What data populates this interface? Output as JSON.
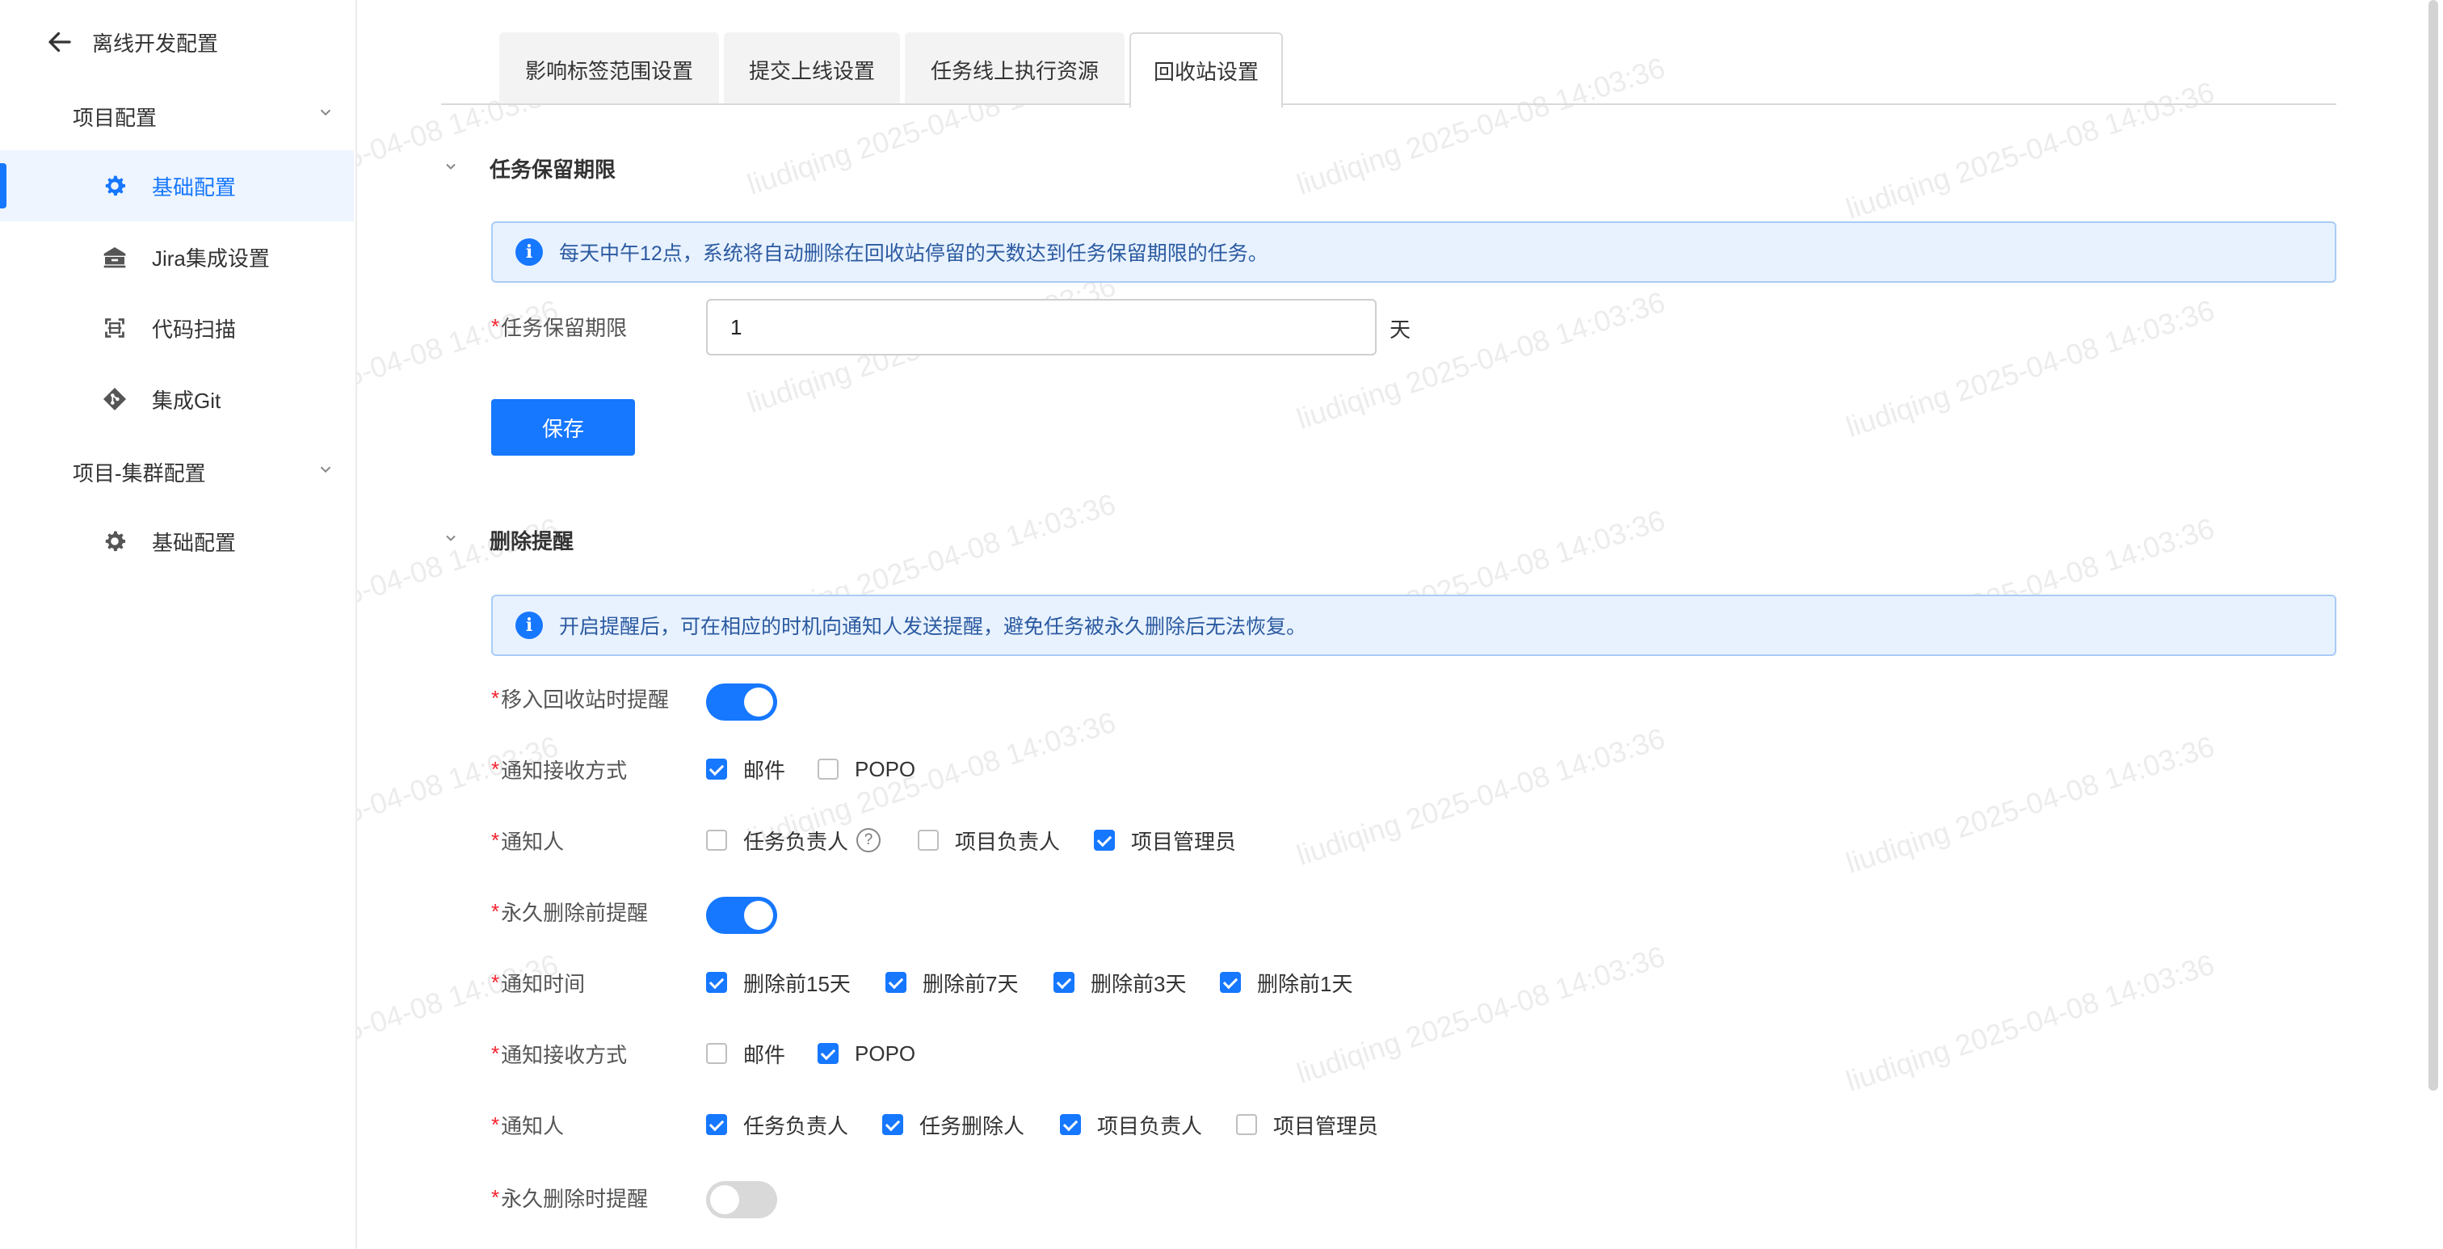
{
  "sidebar": {
    "title": "离线开发配置",
    "groups": [
      {
        "label": "项目配置",
        "items": [
          "基础配置",
          "Jira集成设置",
          "代码扫描",
          "集成Git"
        ]
      },
      {
        "label": "项目-集群配置",
        "items": [
          "基础配置"
        ]
      }
    ],
    "active_item": "基础配置"
  },
  "tabs": [
    "影响标签范围设置",
    "提交上线设置",
    "任务线上执行资源",
    "回收站设置"
  ],
  "active_tab": "回收站设置",
  "section1": {
    "title": "任务保留期限",
    "info": "每天中午12点，系统将自动删除在回收站停留的天数达到任务保留期限的任务。",
    "field_label": "任务保留期限",
    "field_value": "1",
    "unit": "天",
    "save_label": "保存"
  },
  "section2": {
    "title": "删除提醒",
    "info": "开启提醒后，可在相应的时机向通知人发送提醒，避免任务被永久删除后无法恢复。",
    "rows": {
      "move_remind": {
        "label": "移入回收站时提醒",
        "on": true
      },
      "method1": {
        "label": "通知接收方式",
        "options": [
          {
            "text": "邮件",
            "checked": true
          },
          {
            "text": "POPO",
            "checked": false
          }
        ]
      },
      "notifier1": {
        "label": "通知人",
        "options": [
          {
            "text": "任务负责人",
            "checked": false
          },
          {
            "text": "项目负责人",
            "checked": false
          },
          {
            "text": "项目管理员",
            "checked": true
          }
        ]
      },
      "before_remind": {
        "label": "永久删除前提醒",
        "on": true
      },
      "time": {
        "label": "通知时间",
        "options": [
          {
            "text": "删除前15天",
            "checked": true
          },
          {
            "text": "删除前7天",
            "checked": true
          },
          {
            "text": "删除前3天",
            "checked": true
          },
          {
            "text": "删除前1天",
            "checked": true
          }
        ]
      },
      "method2": {
        "label": "通知接收方式",
        "options": [
          {
            "text": "邮件",
            "checked": false
          },
          {
            "text": "POPO",
            "checked": true
          }
        ]
      },
      "notifier2": {
        "label": "通知人",
        "options": [
          {
            "text": "任务负责人",
            "checked": true
          },
          {
            "text": "任务删除人",
            "checked": true
          },
          {
            "text": "项目负责人",
            "checked": true
          },
          {
            "text": "项目管理员",
            "checked": false
          }
        ]
      },
      "delete_remind": {
        "label": "永久删除时提醒",
        "on": false
      }
    }
  },
  "watermark": "liudiqing 2025-04-08 14:03:36",
  "colors": {
    "accent": "#1677ff",
    "required": "#f5222d",
    "info_bg": "#e8f2ff"
  },
  "icons": {
    "back": "arrow-left-icon",
    "settings": "gear-icon",
    "jira": "bank-icon",
    "scan": "scan-icon",
    "git": "git-icon",
    "info": "info-icon",
    "help": "question-icon"
  }
}
